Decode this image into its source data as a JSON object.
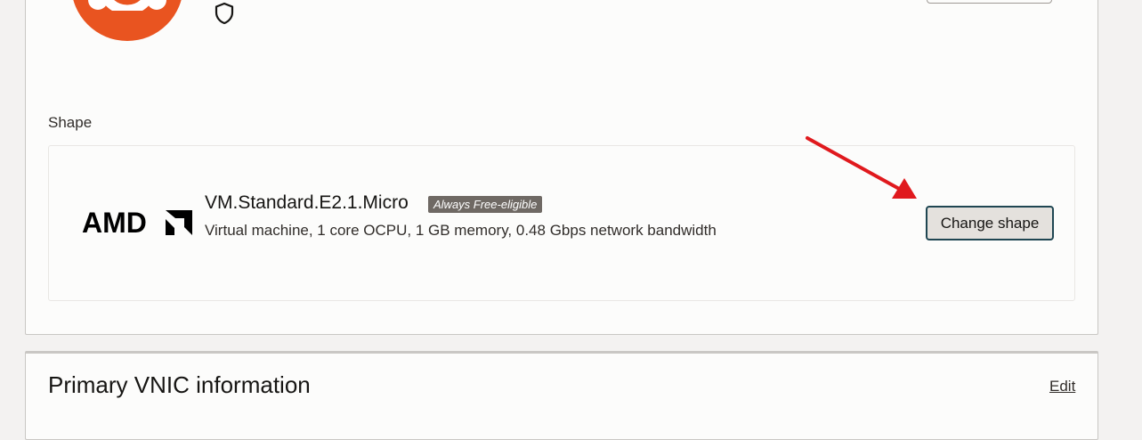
{
  "image_section": {
    "os_logo_icon": "ubuntu-logo-icon",
    "security_icon": "shield-icon"
  },
  "shape_section": {
    "label": "Shape",
    "vendor_logo_text": "AMD",
    "shape_name": "VM.Standard.E2.1.Micro",
    "badge": "Always Free-eligible",
    "description": "Virtual machine, 1 core OCPU, 1 GB memory, 0.48 Gbps network bandwidth",
    "change_button_label": "Change shape"
  },
  "annotation": {
    "arrow_color": "#e0191d"
  },
  "vnic_section": {
    "title": "Primary VNIC information",
    "edit_label": "Edit"
  },
  "colors": {
    "ubuntu_orange": "#e95420",
    "button_focus_border": "#1f4652",
    "badge_bg": "#6f6964"
  }
}
